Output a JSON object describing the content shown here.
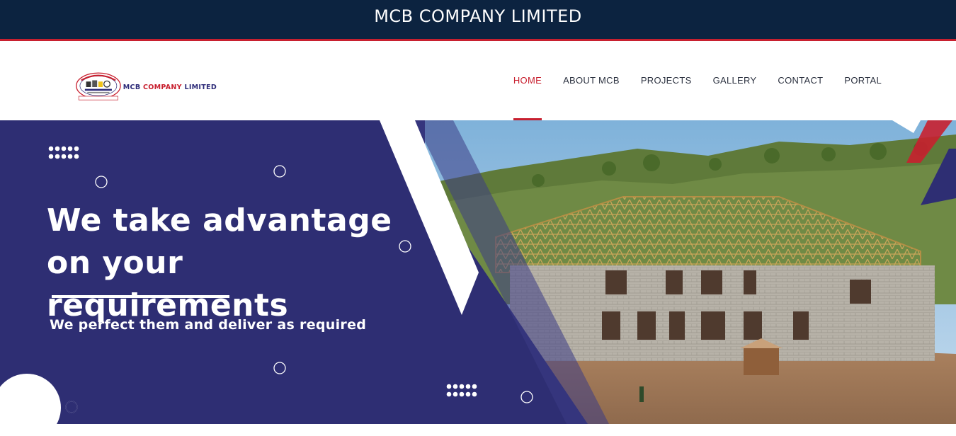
{
  "topbar": {
    "title": "MCB COMPANY LIMITED"
  },
  "logo": {
    "text_main": "MCB ",
    "text_accent": "COMPANY",
    "text_end": " LIMITED"
  },
  "nav": {
    "items": [
      {
        "label": "HOME",
        "active": true
      },
      {
        "label": "ABOUT MCB",
        "active": false
      },
      {
        "label": "PROJECTS",
        "active": false
      },
      {
        "label": "GALLERY",
        "active": false
      },
      {
        "label": "CONTACT",
        "active": false
      },
      {
        "label": "PORTAL",
        "active": false
      }
    ]
  },
  "hero": {
    "heading_line1": "We take advantage",
    "heading_line2": "on your requirements",
    "subheading": "We perfect them and deliver as required"
  },
  "colors": {
    "topbar_bg": "#0c2340",
    "accent_red": "#c8202f",
    "hero_navy": "#2e2e73",
    "white": "#ffffff"
  }
}
